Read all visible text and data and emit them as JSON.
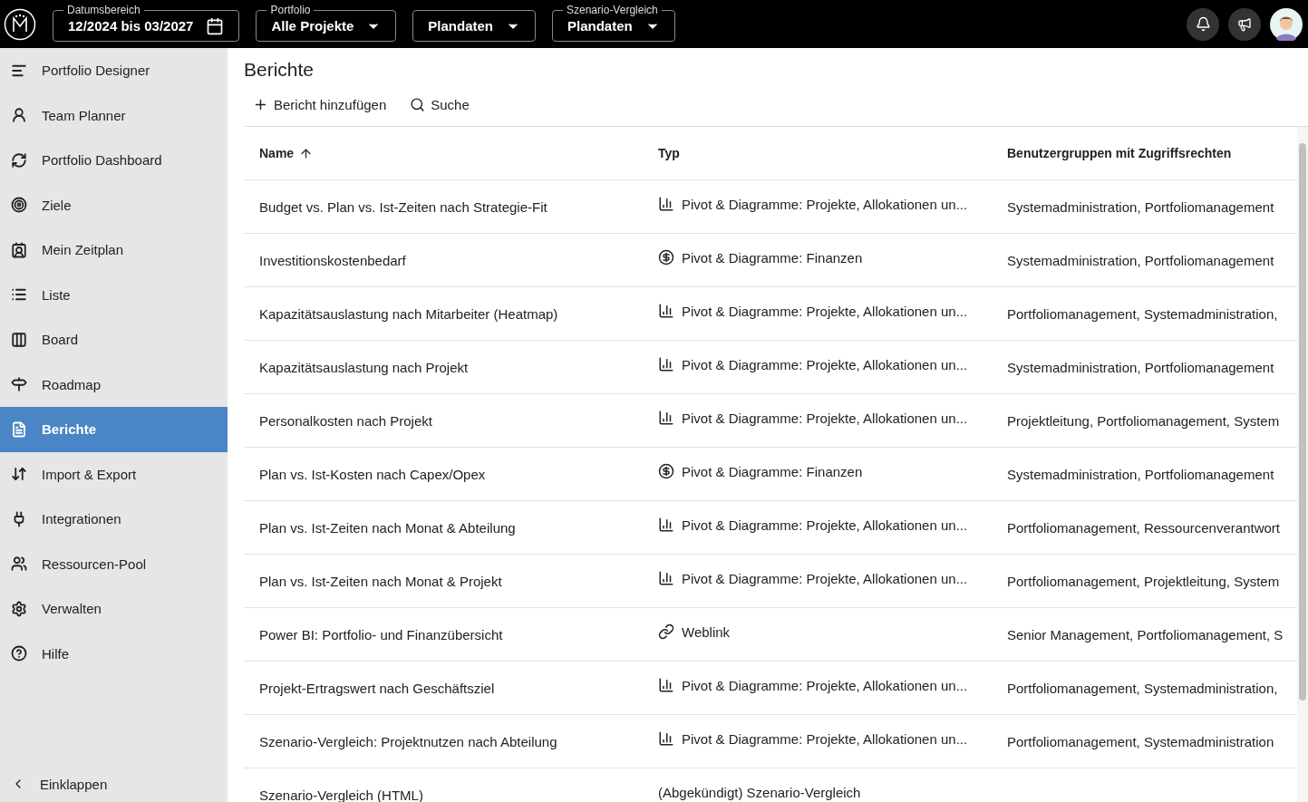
{
  "topbar": {
    "filters": [
      {
        "label": "Datumsbereich",
        "value": "12/2024 bis 03/2027",
        "kind": "date"
      },
      {
        "label": "Portfolio",
        "value": "Alle Projekte",
        "kind": "select"
      },
      {
        "value": "Plandaten",
        "kind": "select"
      },
      {
        "label": "Szenario-Vergleich",
        "value": "Plandaten",
        "kind": "select"
      }
    ]
  },
  "sidebar": {
    "items": [
      {
        "label": "Portfolio Designer",
        "selected": false
      },
      {
        "label": "Team Planner",
        "selected": false
      },
      {
        "label": "Portfolio Dashboard",
        "selected": false
      },
      {
        "label": "Ziele",
        "selected": false
      },
      {
        "label": "Mein Zeitplan",
        "selected": false
      },
      {
        "label": "Liste",
        "selected": false
      },
      {
        "label": "Board",
        "selected": false
      },
      {
        "label": "Roadmap",
        "selected": false
      },
      {
        "label": "Berichte",
        "selected": true
      },
      {
        "label": "Import & Export",
        "selected": false
      },
      {
        "label": "Integrationen",
        "selected": false
      },
      {
        "label": "Ressourcen-Pool",
        "selected": false
      },
      {
        "label": "Verwalten",
        "selected": false
      },
      {
        "label": "Hilfe",
        "selected": false
      }
    ],
    "collapse": "Einklappen"
  },
  "page": {
    "title": "Berichte",
    "actions": [
      {
        "label": "Bericht hinzufügen",
        "kind": "add"
      },
      {
        "label": "Suche",
        "kind": "search"
      }
    ]
  },
  "table": {
    "columns": [
      "Name",
      "Typ",
      "Benutzergruppen mit Zugriffsrechten"
    ],
    "rows": [
      {
        "name": "Budget vs. Plan vs. Ist-Zeiten nach Strategie-Fit",
        "type": "Pivot & Diagramme: Projekte, Allokationen un...",
        "kind": "pivot",
        "groups": "Systemadministration, Portfoliomanagement"
      },
      {
        "name": "Investitionskostenbedarf",
        "type": "Pivot & Diagramme: Finanzen",
        "kind": "finance",
        "groups": "Systemadministration, Portfoliomanagement"
      },
      {
        "name": "Kapazitätsauslastung nach Mitarbeiter (Heatmap)",
        "type": "Pivot & Diagramme: Projekte, Allokationen un...",
        "kind": "pivot",
        "groups": "Portfoliomanagement, Systemadministration,"
      },
      {
        "name": "Kapazitätsauslastung nach Projekt",
        "type": "Pivot & Diagramme: Projekte, Allokationen un...",
        "kind": "pivot",
        "groups": "Systemadministration, Portfoliomanagement"
      },
      {
        "name": "Personalkosten nach Projekt",
        "type": "Pivot & Diagramme: Projekte, Allokationen un...",
        "kind": "pivot",
        "groups": "Projektleitung, Portfoliomanagement, System"
      },
      {
        "name": "Plan vs. Ist-Kosten nach Capex/Opex",
        "type": "Pivot & Diagramme: Finanzen",
        "kind": "finance",
        "groups": "Systemadministration, Portfoliomanagement"
      },
      {
        "name": "Plan vs. Ist-Zeiten nach Monat & Abteilung",
        "type": "Pivot & Diagramme: Projekte, Allokationen un...",
        "kind": "pivot",
        "groups": "Portfoliomanagement, Ressourcenverantwort"
      },
      {
        "name": "Plan vs. Ist-Zeiten nach Monat & Projekt",
        "type": "Pivot & Diagramme: Projekte, Allokationen un...",
        "kind": "pivot",
        "groups": "Portfoliomanagement, Projektleitung, System"
      },
      {
        "name": "Power BI: Portfolio- und Finanzübersicht",
        "type": "Weblink",
        "kind": "link",
        "groups": "Senior Management, Portfoliomanagement, S"
      },
      {
        "name": "Projekt-Ertragswert nach Geschäftsziel",
        "type": "Pivot & Diagramme: Projekte, Allokationen un...",
        "kind": "pivot",
        "groups": "Portfoliomanagement, Systemadministration,"
      },
      {
        "name": "Szenario-Vergleich: Projektnutzen nach Abteilung",
        "type": "Pivot & Diagramme: Projekte, Allokationen un...",
        "kind": "pivot",
        "groups": "Portfoliomanagement, Systemadministration"
      },
      {
        "name": "Szenario-Vergleich (HTML)",
        "type": "(Abgekündigt) Szenario-Vergleich",
        "kind": "plain"
      }
    ]
  }
}
